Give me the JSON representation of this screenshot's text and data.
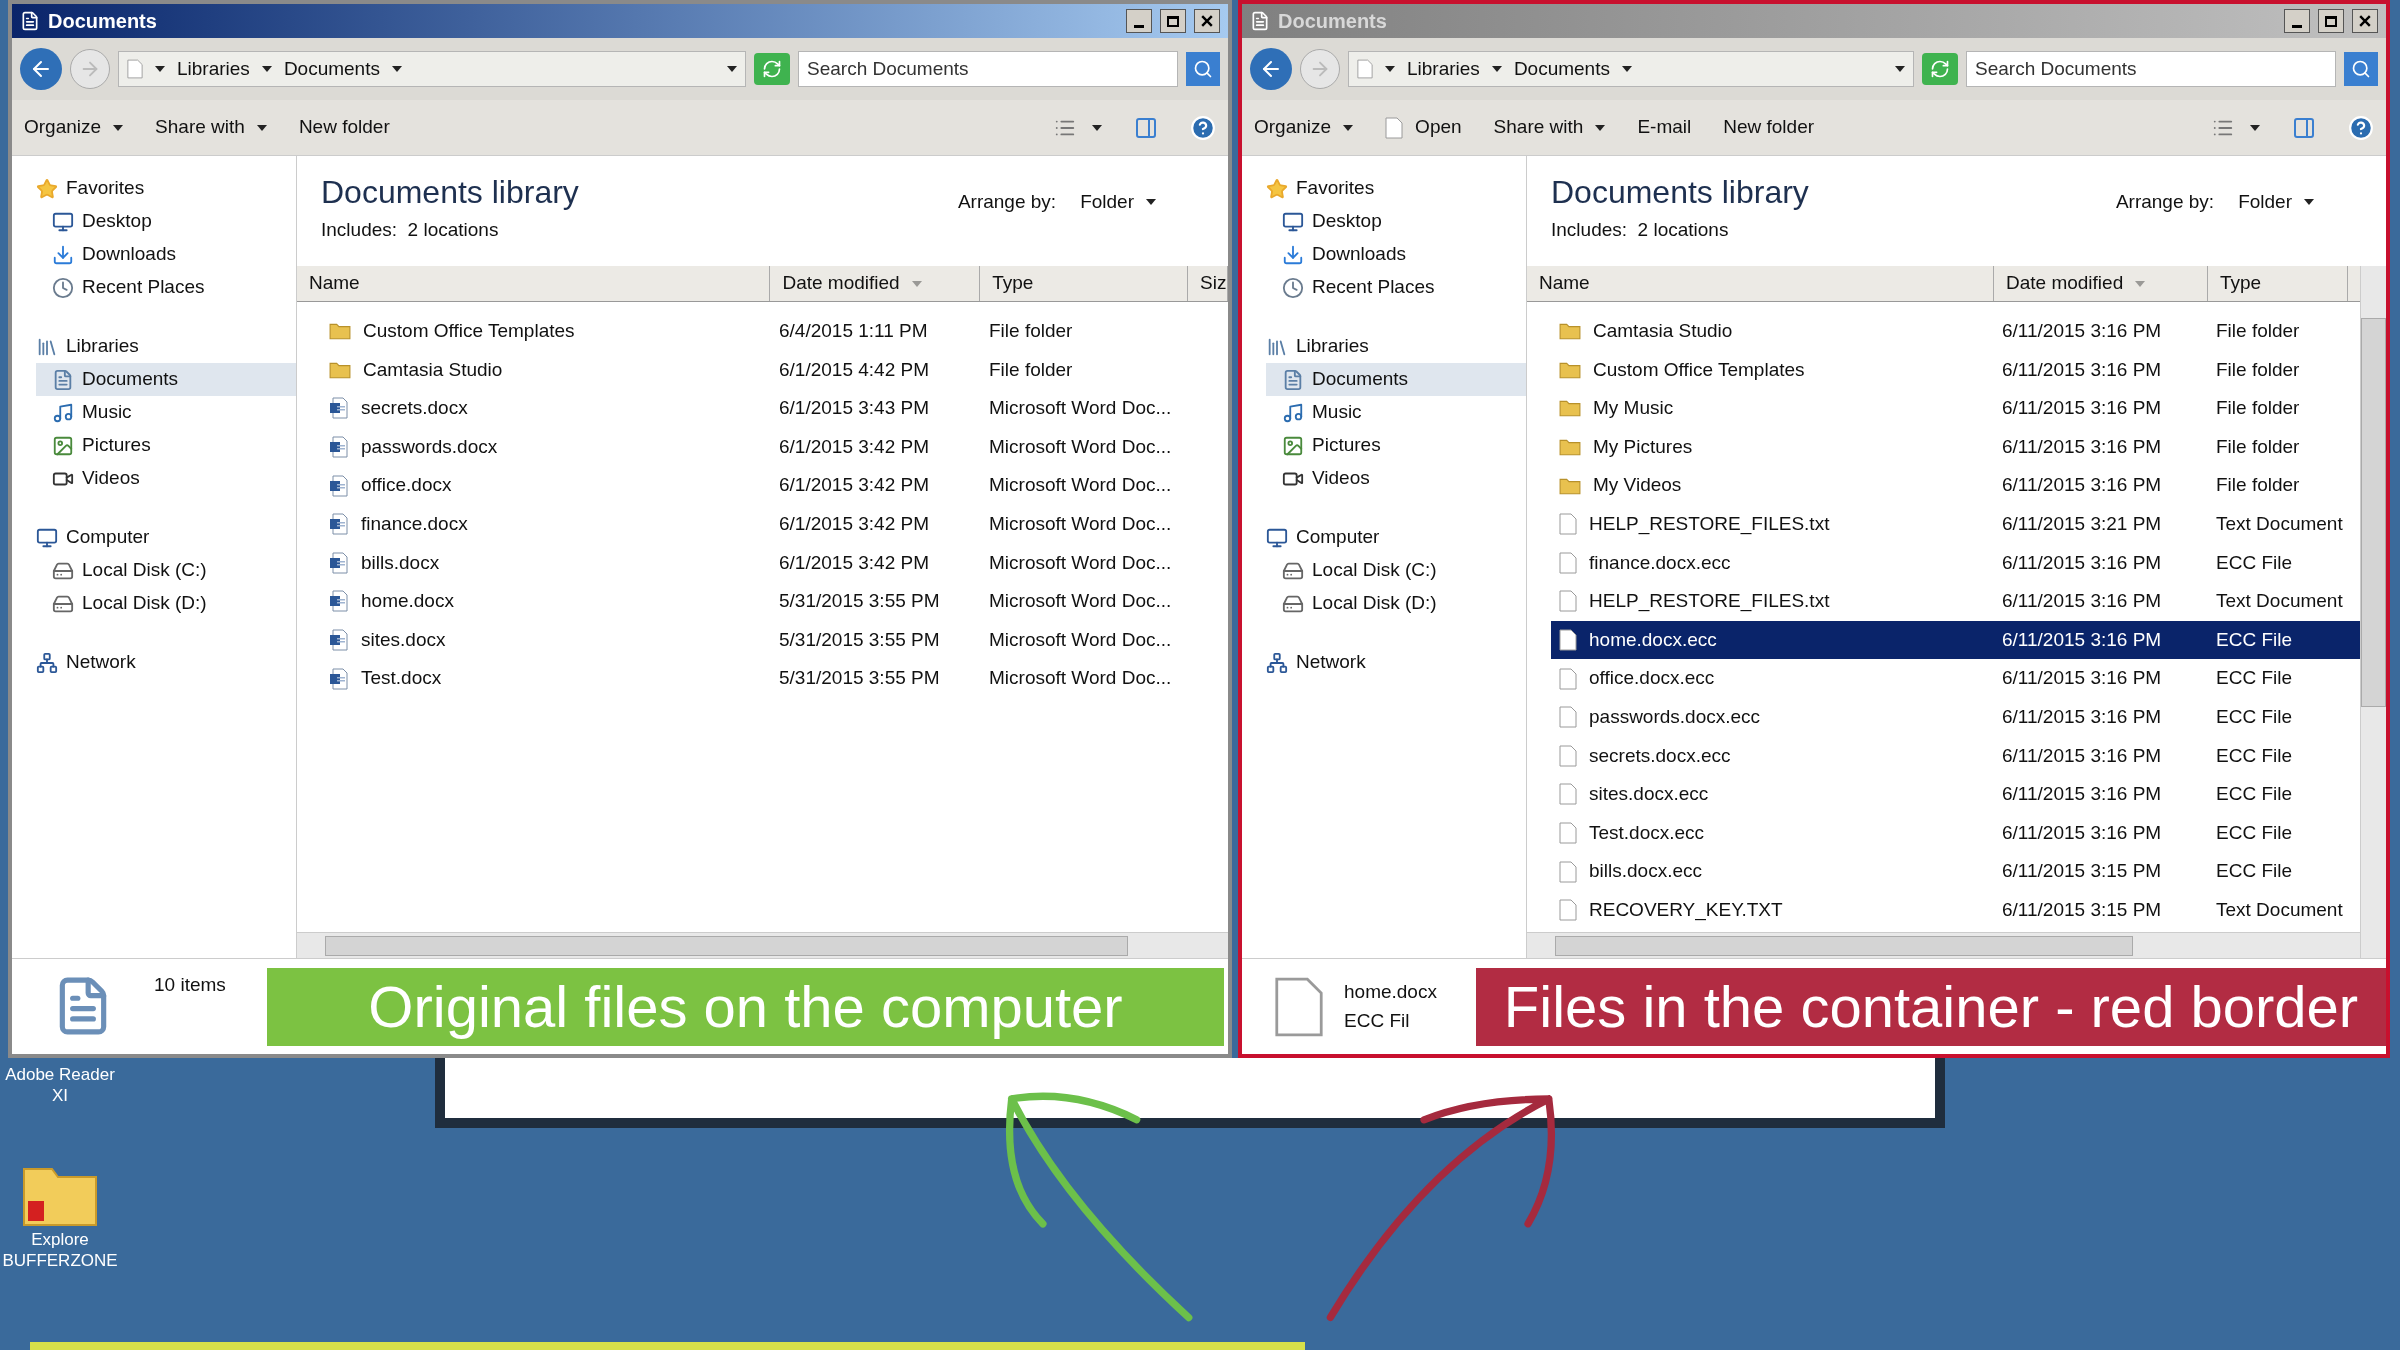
{
  "windows": [
    {
      "title": "Documents",
      "active": true,
      "color": "#8a8a8a",
      "breadcrumb": [
        "Libraries",
        "Documents"
      ],
      "search": {
        "placeholder": "Search Documents"
      },
      "commands": [
        {
          "label": "Organize",
          "kind": "dropdown"
        },
        {
          "label": "Share with",
          "kind": "dropdown"
        },
        {
          "label": "New folder",
          "kind": "plain"
        }
      ],
      "nav": [
        {
          "label": "Favorites",
          "children": [
            {
              "label": "Desktop",
              "selected": false
            },
            {
              "label": "Downloads",
              "selected": false
            },
            {
              "label": "Recent Places",
              "selected": false
            }
          ]
        },
        {
          "label": "Libraries",
          "children": [
            {
              "label": "Documents",
              "selected": true
            },
            {
              "label": "Music",
              "selected": false
            },
            {
              "label": "Pictures",
              "selected": false
            },
            {
              "label": "Videos",
              "selected": false
            }
          ]
        },
        {
          "label": "Computer",
          "children": [
            {
              "label": "Local Disk (C:)",
              "selected": false
            },
            {
              "label": "Local Disk (D:)",
              "selected": false
            }
          ]
        },
        {
          "label": "Network"
        }
      ],
      "library": {
        "title": "Documents library",
        "includes": "Includes:  2 locations",
        "arrange_label": "Arrange by:",
        "arrange_value": "Folder"
      },
      "columns": [
        "Name",
        "Date modified",
        "Type",
        "Siz"
      ],
      "rows": [
        {
          "name": "Custom Office Templates",
          "date": "6/4/2015 1:11 PM",
          "type": "File folder",
          "kind": "folder",
          "selected": false
        },
        {
          "name": "Camtasia Studio",
          "date": "6/1/2015 4:42 PM",
          "type": "File folder",
          "kind": "folder",
          "selected": false
        },
        {
          "name": "secrets.docx",
          "date": "6/1/2015 3:43 PM",
          "type": "Microsoft Word Doc...",
          "kind": "word",
          "selected": false
        },
        {
          "name": "passwords.docx",
          "date": "6/1/2015 3:42 PM",
          "type": "Microsoft Word Doc...",
          "kind": "word",
          "selected": false
        },
        {
          "name": "office.docx",
          "date": "6/1/2015 3:42 PM",
          "type": "Microsoft Word Doc...",
          "kind": "word",
          "selected": false
        },
        {
          "name": "finance.docx",
          "date": "6/1/2015 3:42 PM",
          "type": "Microsoft Word Doc...",
          "kind": "word",
          "selected": false
        },
        {
          "name": "bills.docx",
          "date": "6/1/2015 3:42 PM",
          "type": "Microsoft Word Doc...",
          "kind": "word",
          "selected": false
        },
        {
          "name": "home.docx",
          "date": "5/31/2015 3:55 PM",
          "type": "Microsoft Word Doc...",
          "kind": "word",
          "selected": false
        },
        {
          "name": "sites.docx",
          "date": "5/31/2015 3:55 PM",
          "type": "Microsoft Word Doc...",
          "kind": "word",
          "selected": false
        },
        {
          "name": "Test.docx",
          "date": "5/31/2015 3:55 PM",
          "type": "Microsoft Word Doc...",
          "kind": "word",
          "selected": false
        }
      ],
      "details": {
        "kind": "count",
        "primary": "10 items"
      },
      "banner": {
        "text": "Original files on the computer",
        "color": "#7cc242"
      }
    },
    {
      "title": "Documents",
      "active": false,
      "color": "#c8102e",
      "breadcrumb": [
        "Libraries",
        "Documents"
      ],
      "search": {
        "placeholder": "Search Documents"
      },
      "commands": [
        {
          "label": "Organize",
          "kind": "dropdown"
        },
        {
          "label": "Open",
          "kind": "file"
        },
        {
          "label": "Share with",
          "kind": "dropdown"
        },
        {
          "label": "E-mail",
          "kind": "plain"
        },
        {
          "label": "New folder",
          "kind": "plain"
        }
      ],
      "nav": [
        {
          "label": "Favorites",
          "children": [
            {
              "label": "Desktop",
              "selected": false
            },
            {
              "label": "Downloads",
              "selected": false
            },
            {
              "label": "Recent Places",
              "selected": false
            }
          ]
        },
        {
          "label": "Libraries",
          "children": [
            {
              "label": "Documents",
              "selected": true
            },
            {
              "label": "Music",
              "selected": false
            },
            {
              "label": "Pictures",
              "selected": false
            },
            {
              "label": "Videos",
              "selected": false
            }
          ]
        },
        {
          "label": "Computer",
          "children": [
            {
              "label": "Local Disk (C:)",
              "selected": false
            },
            {
              "label": "Local Disk (D:)",
              "selected": false
            }
          ]
        },
        {
          "label": "Network"
        }
      ],
      "library": {
        "title": "Documents library",
        "includes": "Includes:  2 locations",
        "arrange_label": "Arrange by:",
        "arrange_value": "Folder"
      },
      "columns": [
        "Name",
        "Date modified",
        "Type"
      ],
      "rows": [
        {
          "name": "Camtasia Studio",
          "date": "6/11/2015 3:16 PM",
          "type": "File folder",
          "kind": "folder",
          "selected": false
        },
        {
          "name": "Custom Office Templates",
          "date": "6/11/2015 3:16 PM",
          "type": "File folder",
          "kind": "folder",
          "selected": false
        },
        {
          "name": "My Music",
          "date": "6/11/2015 3:16 PM",
          "type": "File folder",
          "kind": "folder",
          "selected": false
        },
        {
          "name": "My Pictures",
          "date": "6/11/2015 3:16 PM",
          "type": "File folder",
          "kind": "folder",
          "selected": false
        },
        {
          "name": "My Videos",
          "date": "6/11/2015 3:16 PM",
          "type": "File folder",
          "kind": "folder",
          "selected": false
        },
        {
          "name": "HELP_RESTORE_FILES.txt",
          "date": "6/11/2015 3:21 PM",
          "type": "Text Document",
          "kind": "file",
          "selected": false
        },
        {
          "name": "finance.docx.ecc",
          "date": "6/11/2015 3:16 PM",
          "type": "ECC File",
          "kind": "file",
          "selected": false
        },
        {
          "name": "HELP_RESTORE_FILES.txt",
          "date": "6/11/2015 3:16 PM",
          "type": "Text Document",
          "kind": "file",
          "selected": false
        },
        {
          "name": "home.docx.ecc",
          "date": "6/11/2015 3:16 PM",
          "type": "ECC File",
          "kind": "file",
          "selected": true
        },
        {
          "name": "office.docx.ecc",
          "date": "6/11/2015 3:16 PM",
          "type": "ECC File",
          "kind": "file",
          "selected": false
        },
        {
          "name": "passwords.docx.ecc",
          "date": "6/11/2015 3:16 PM",
          "type": "ECC File",
          "kind": "file",
          "selected": false
        },
        {
          "name": "secrets.docx.ecc",
          "date": "6/11/2015 3:16 PM",
          "type": "ECC File",
          "kind": "file",
          "selected": false
        },
        {
          "name": "sites.docx.ecc",
          "date": "6/11/2015 3:16 PM",
          "type": "ECC File",
          "kind": "file",
          "selected": false
        },
        {
          "name": "Test.docx.ecc",
          "date": "6/11/2015 3:16 PM",
          "type": "ECC File",
          "kind": "file",
          "selected": false
        },
        {
          "name": "bills.docx.ecc",
          "date": "6/11/2015 3:15 PM",
          "type": "ECC File",
          "kind": "file",
          "selected": false
        },
        {
          "name": "RECOVERY_KEY.TXT",
          "date": "6/11/2015 3:15 PM",
          "type": "Text Document",
          "kind": "file",
          "selected": false
        }
      ],
      "details": {
        "kind": "file",
        "primary": "home.docx",
        "secondary": "ECC Fil"
      },
      "banner": {
        "text": "Files in the container - red border",
        "color": "#b22c43"
      }
    }
  ],
  "desktop_icons": [
    {
      "label": "Adobe Reader XI",
      "kind": "reader"
    },
    {
      "label": "Explore BUFFERZONE",
      "kind": "folder"
    }
  ]
}
